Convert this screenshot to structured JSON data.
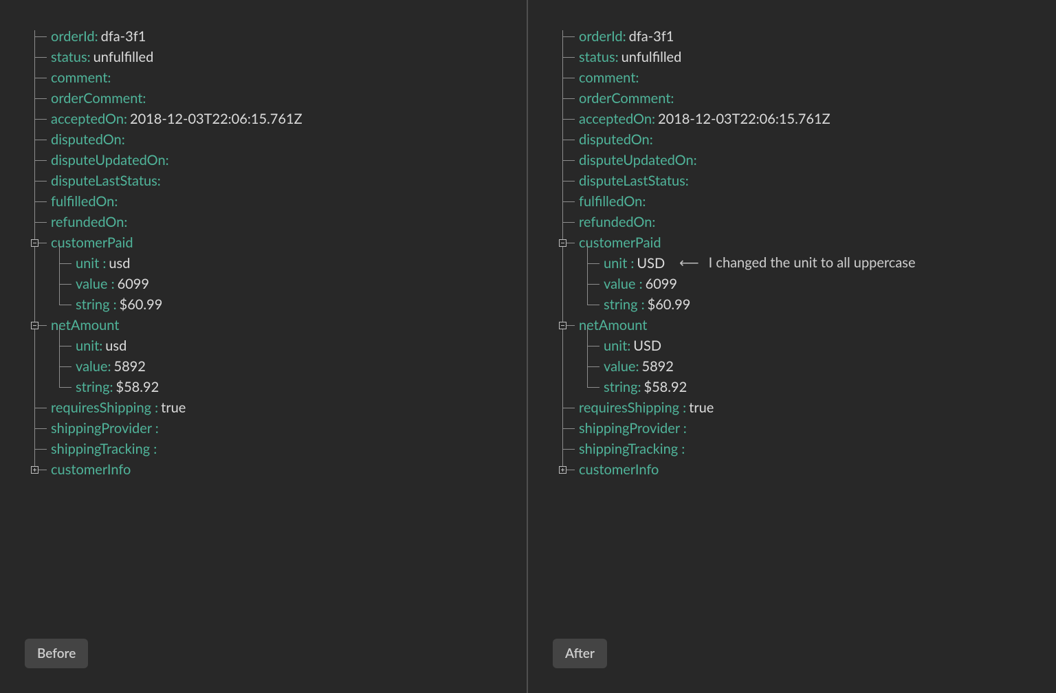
{
  "labels": {
    "before": "Before",
    "after": "After"
  },
  "keys": {
    "orderId": "orderId:",
    "status": "status:",
    "comment": "comment:",
    "orderComment": "orderComment:",
    "acceptedOn": "acceptedOn:",
    "disputedOn": "disputedOn:",
    "disputeUpdatedOn": "disputeUpdatedOn:",
    "disputeLastStatus": "disputeLastStatus:",
    "fulfilledOn": "fulfilledOn:",
    "refundedOn": "refundedOn:",
    "customerPaid": "customerPaid",
    "netAmount": "netAmount",
    "requiresShipping": "requiresShipping :",
    "shippingProvider": "shippingProvider :",
    "shippingTracking": "shippingTracking :",
    "customerInfo": "customerInfo",
    "unit_sp": "unit :",
    "value_sp": "value :",
    "string_sp": "string :",
    "unit": "unit:",
    "value": "value:",
    "string": "string:"
  },
  "before": {
    "orderId": "dfa-3f1",
    "status": "unfulfilled",
    "comment": "",
    "orderComment": "",
    "acceptedOn": "2018-12-03T22:06:15.761Z",
    "disputedOn": "",
    "disputeUpdatedOn": "",
    "disputeLastStatus": "",
    "fulfilledOn": "",
    "refundedOn": "",
    "customerPaid": {
      "unit": "usd",
      "value": "6099",
      "string": "$60.99"
    },
    "netAmount": {
      "unit": "usd",
      "value": "5892",
      "string": "$58.92"
    },
    "requiresShipping": "true",
    "shippingProvider": "",
    "shippingTracking": ""
  },
  "after": {
    "orderId": "dfa-3f1",
    "status": "unfulfilled",
    "comment": "",
    "orderComment": "",
    "acceptedOn": "2018-12-03T22:06:15.761Z",
    "disputedOn": "",
    "disputeUpdatedOn": "",
    "disputeLastStatus": "",
    "fulfilledOn": "",
    "refundedOn": "",
    "customerPaid": {
      "unit": "USD",
      "value": "6099",
      "string": "$60.99"
    },
    "netAmount": {
      "unit": "USD",
      "value": "5892",
      "string": "$58.92"
    },
    "requiresShipping": "true",
    "shippingProvider": "",
    "shippingTracking": ""
  },
  "annotation": {
    "arrow": "⟵",
    "text": "I changed the unit to all uppercase"
  }
}
